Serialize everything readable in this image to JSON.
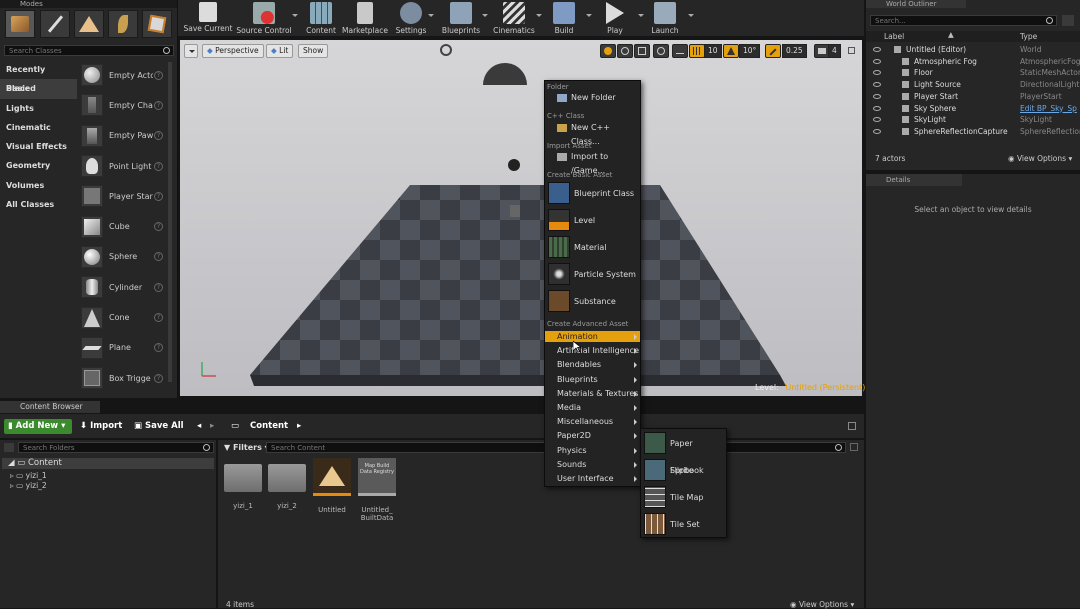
{
  "modes": {
    "tab_title": "Modes",
    "search_placeholder": "Search Classes",
    "categories": [
      "Recently Placed",
      "Basic",
      "Lights",
      "Cinematic",
      "Visual Effects",
      "Geometry",
      "Volumes",
      "All Classes"
    ],
    "selected_category": "Basic",
    "classes": [
      "Empty Actc",
      "Empty Chai",
      "Empty Paw",
      "Point Light",
      "Player Star",
      "Cube",
      "Sphere",
      "Cylinder",
      "Cone",
      "Plane",
      "Box Trigge"
    ]
  },
  "toolbar": {
    "buttons": [
      "Save Current",
      "Source Control",
      "Content",
      "Marketplace",
      "Settings",
      "Blueprints",
      "Cinematics",
      "Build",
      "Play",
      "Launch"
    ]
  },
  "viewport": {
    "perspective_label": "Perspective",
    "lit_label": "Lit",
    "show_label": "Show",
    "grid_snap": "10",
    "rotation_snap": "10°",
    "scale_snap": "0.25",
    "camera_speed": "4",
    "level_label": "Level:",
    "level_name": "Untitled (Persistent)"
  },
  "outliner": {
    "tab_title": "World Outliner",
    "search_placeholder": "Search...",
    "col_label": "Label",
    "col_type": "Type",
    "rows": [
      {
        "label": "Untitled (Editor)",
        "type": "World"
      },
      {
        "label": "Atmospheric Fog",
        "type": "AtmosphericFog"
      },
      {
        "label": "Floor",
        "type": "StaticMeshActor"
      },
      {
        "label": "Light Source",
        "type": "DirectionalLight"
      },
      {
        "label": "Player Start",
        "type": "PlayerStart"
      },
      {
        "label": "Sky Sphere",
        "type": "Edit BP_Sky_Sp"
      },
      {
        "label": "SkyLight",
        "type": "SkyLight"
      },
      {
        "label": "SphereReflectionCapture",
        "type": "SphereReflection"
      }
    ],
    "actor_count": "7 actors",
    "view_options": "View Options"
  },
  "details": {
    "tab_title": "Details",
    "empty_message": "Select an object to view details"
  },
  "content_browser": {
    "tab_title": "Content Browser",
    "add_new": "Add New",
    "import": "Import",
    "save_all": "Save All",
    "path_root": "Content",
    "search_folders_placeholder": "Search Folders",
    "filters_label": "Filters",
    "search_content_placeholder": "Search Content",
    "tree_root": "Content",
    "tree_children": [
      "yizi_1",
      "yizi_2"
    ],
    "assets": [
      {
        "name": "yizi_1",
        "kind": "folder"
      },
      {
        "name": "yizi_2",
        "kind": "folder"
      },
      {
        "name": "Untitled",
        "kind": "level"
      },
      {
        "name": "Untitled_ BuiltData",
        "kind": "data",
        "thumb_text": "Map Build Data Registry"
      }
    ],
    "item_count": "4 items",
    "view_options": "View Options"
  },
  "context_menu": {
    "folder_header": "Folder",
    "new_folder": "New Folder",
    "cpp_header": "C++ Class",
    "new_cpp": "New C++ Class...",
    "import_header": "Import Asset",
    "import_to": "Import to /Game...",
    "basic_header": "Create Basic Asset",
    "basic_items": [
      "Blueprint Class",
      "Level",
      "Material",
      "Particle System",
      "Substance"
    ],
    "advanced_header": "Create Advanced Asset",
    "advanced_items": [
      "Animation",
      "Artificial Intelligence",
      "Blendables",
      "Blueprints",
      "Materials & Textures",
      "Media",
      "Miscellaneous",
      "Paper2D",
      "Physics",
      "Sounds",
      "User Interface"
    ],
    "highlighted_item": "Animation"
  },
  "submenu": {
    "items": [
      "Paper Flipbook",
      "Sprite",
      "Tile Map",
      "Tile Set"
    ]
  },
  "colors": {
    "accent": "#e5a00d",
    "add_new_green": "#3c8a2e",
    "panel": "#262626"
  }
}
